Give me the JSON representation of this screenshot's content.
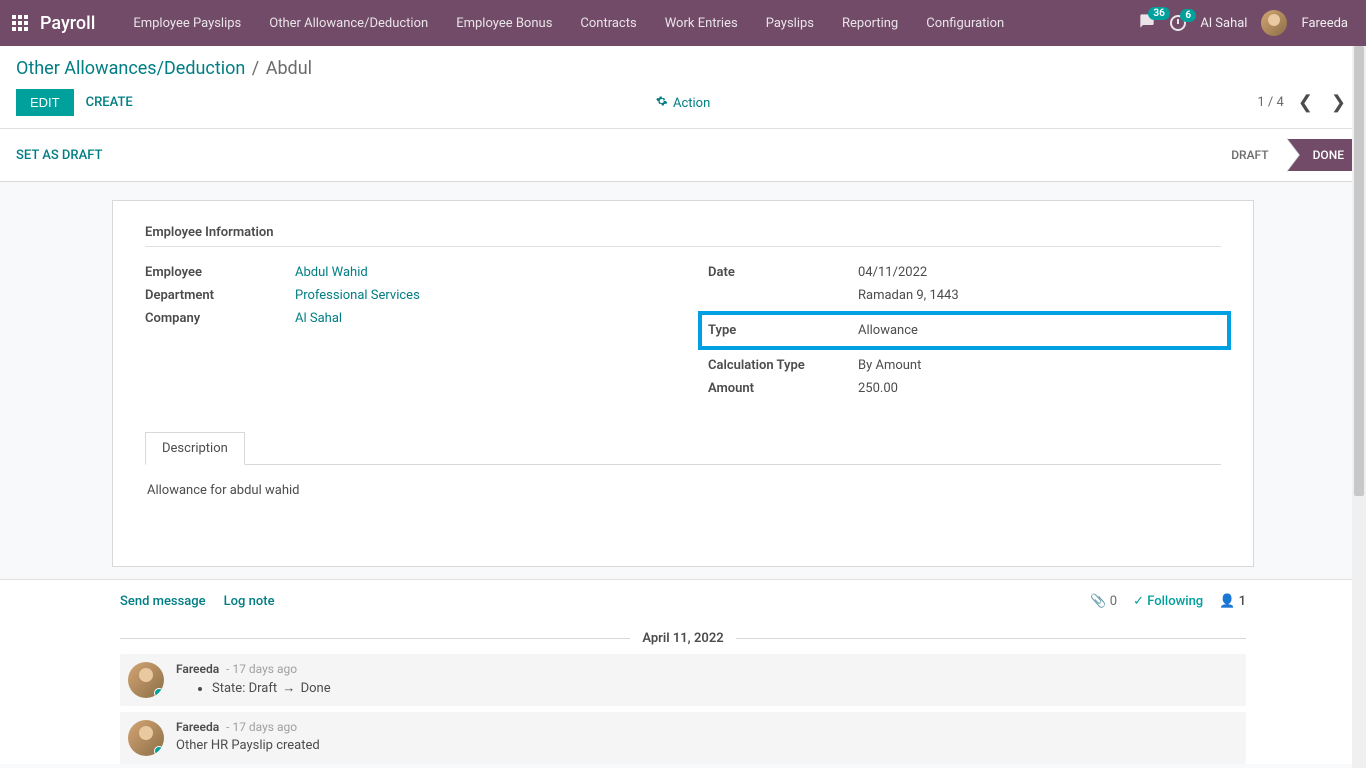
{
  "topnav": {
    "brand": "Payroll",
    "menu": [
      "Employee Payslips",
      "Other Allowance/Deduction",
      "Employee Bonus",
      "Contracts",
      "Work Entries",
      "Payslips",
      "Reporting",
      "Configuration"
    ],
    "chat_badge": "36",
    "clock_badge": "6",
    "company": "Al Sahal",
    "user": "Fareeda"
  },
  "breadcrumb": {
    "parent": "Other Allowances/Deduction",
    "current": "Abdul"
  },
  "controls": {
    "edit": "EDIT",
    "create": "CREATE",
    "action": "Action",
    "pager": "1 / 4"
  },
  "statusbar": {
    "set_draft": "SET AS DRAFT",
    "steps": [
      "DRAFT",
      "DONE"
    ]
  },
  "form": {
    "section_title": "Employee Information",
    "left": {
      "employee_label": "Employee",
      "employee_value": "Abdul Wahid",
      "department_label": "Department",
      "department_value": "Professional Services",
      "company_label": "Company",
      "company_value": "Al Sahal"
    },
    "right": {
      "date_label": "Date",
      "date_value": "04/11/2022",
      "date_alt": "Ramadan 9, 1443",
      "type_label": "Type",
      "type_value": "Allowance",
      "calc_label": "Calculation Type",
      "calc_value": "By Amount",
      "amount_label": "Amount",
      "amount_value": "250.00"
    },
    "tab_label": "Description",
    "description": "Allowance for abdul wahid"
  },
  "chatter": {
    "send": "Send message",
    "log": "Log note",
    "attach_count": "0",
    "following": "Following",
    "followers": "1",
    "date": "April 11, 2022",
    "messages": [
      {
        "author": "Fareeda",
        "time": "- 17 days ago",
        "type": "track",
        "field": "State:",
        "old": "Draft",
        "new": "Done"
      },
      {
        "author": "Fareeda",
        "time": "- 17 days ago",
        "type": "text",
        "text": "Other HR Payslip created"
      }
    ]
  }
}
